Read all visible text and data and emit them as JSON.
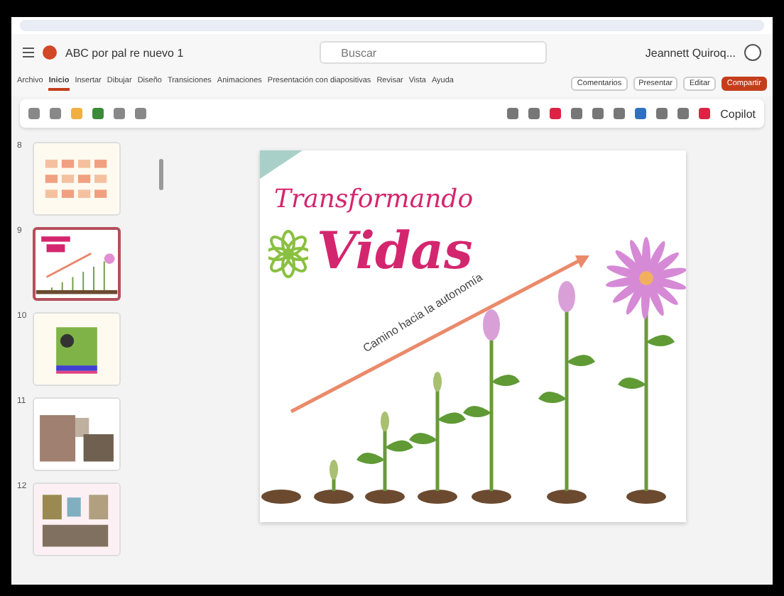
{
  "app_bar": {
    "file_name": "ABC por pal re nuevo 1",
    "search": {
      "placeholder": "Buscar"
    },
    "user": "Jeannett Quiroq..."
  },
  "ribbon_tabs": [
    {
      "label": "Archivo",
      "selected": false
    },
    {
      "label": "Inicio",
      "selected": true
    },
    {
      "label": "Insertar",
      "selected": false
    },
    {
      "label": "Dibujar",
      "selected": false
    },
    {
      "label": "Diseño",
      "selected": false
    },
    {
      "label": "Transiciones",
      "selected": false
    },
    {
      "label": "Animaciones",
      "selected": false
    },
    {
      "label": "Presentación con diapositivas",
      "selected": false
    },
    {
      "label": "Revisar",
      "selected": false
    },
    {
      "label": "Vista",
      "selected": false
    },
    {
      "label": "Ayuda",
      "selected": false
    }
  ],
  "actions": [
    {
      "label": "Comentarios",
      "kind": "plain"
    },
    {
      "label": "Presentar",
      "kind": "plain"
    },
    {
      "label": "Editar",
      "kind": "plain"
    },
    {
      "label": "Compartir",
      "kind": "primary"
    }
  ],
  "toolbar": {
    "designer": "Copilot"
  },
  "slides": [
    {
      "number": "8",
      "selected": false,
      "kind": "grid"
    },
    {
      "number": "9",
      "selected": true,
      "kind": "plants"
    },
    {
      "number": "10",
      "selected": false,
      "kind": "poster"
    },
    {
      "number": "11",
      "selected": false,
      "kind": "photos"
    },
    {
      "number": "12",
      "selected": false,
      "kind": "collage"
    }
  ],
  "slide": {
    "title_top": "Transformando",
    "title_main": "Vidas",
    "arrow_label": "Camino hacia la autonomía"
  }
}
